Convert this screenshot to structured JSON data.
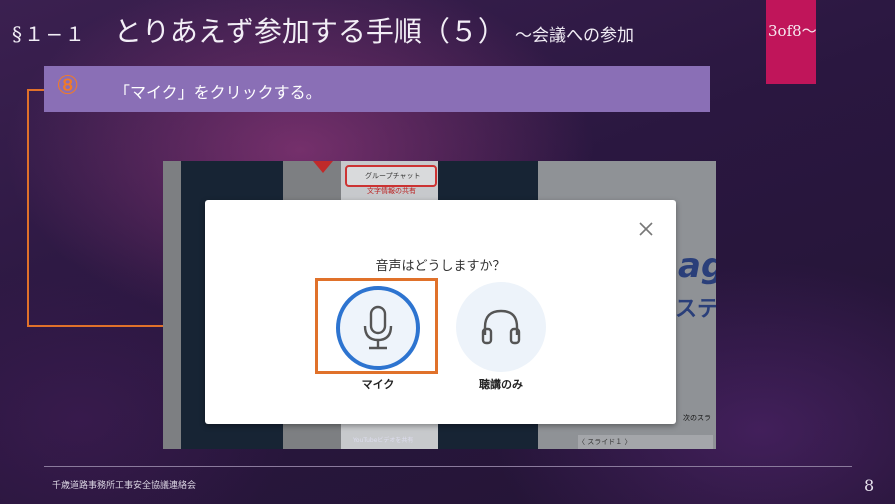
{
  "header": {
    "section": "§１−１",
    "title": "とりあえず参加する手順（５）",
    "subtitle": "〜会議への参加",
    "page_tag": "3of8〜"
  },
  "step": {
    "number": "⑧",
    "instruction": "「マイク」をクリックする。"
  },
  "screenshot": {
    "chip_label": "グループチャット",
    "chip_sub": "文字情報の共有",
    "youtube_text": "YouTubeビデオを共有",
    "next_slide": "次のスラ",
    "nav_text": "〈 スライド１ 〉",
    "big_text_1": "ag",
    "big_text_2": "ステ"
  },
  "dialog": {
    "question": "音声はどうしますか？",
    "mic_label": "マイク",
    "listen_label": "聴講のみ"
  },
  "footer": {
    "org": "千歳道路事務所工事安全協議連絡会",
    "page_number": "8"
  },
  "colors": {
    "accent_orange": "#e0712a",
    "tag_magenta": "#c0155a",
    "banner_purple": "#8a6fb6",
    "mic_blue": "#2d74d0"
  },
  "icons": {
    "close": "close-icon",
    "mic": "microphone-icon",
    "listen": "headphones-icon"
  }
}
